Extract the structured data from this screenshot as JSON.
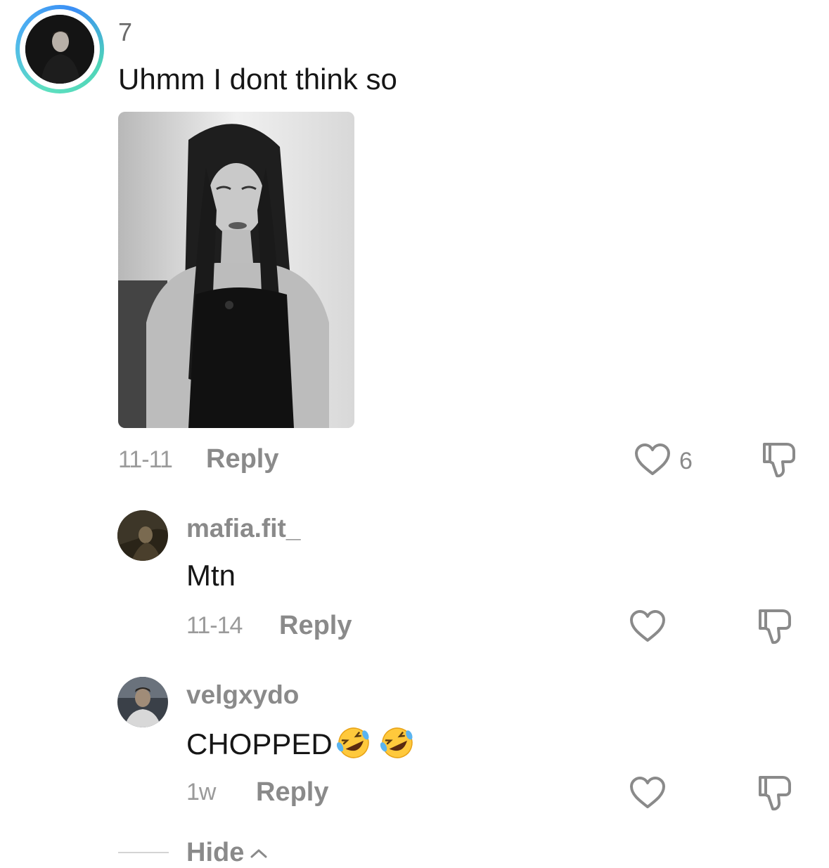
{
  "main_comment": {
    "username": "7",
    "text": "Uhmm I dont think so",
    "date": "11-11",
    "reply_label": "Reply",
    "like_count": "6",
    "avatar_ring_colors": [
      "#5ee0c0",
      "#3a8ef5"
    ]
  },
  "replies": [
    {
      "username": "mafia.fit_",
      "text": "Mtn",
      "date": "11-14",
      "reply_label": "Reply"
    },
    {
      "username": "velgxydo",
      "text": "CHOPPED",
      "emojis": [
        "rolling-on-floor-laughing-emoji",
        "rolling-on-floor-laughing-emoji"
      ],
      "date": "1w",
      "reply_label": "Reply"
    }
  ],
  "hide_label": "Hide",
  "icons": {
    "like": "heart-outline-icon",
    "dislike": "thumbs-down-outline-icon",
    "collapse": "chevron-up-icon"
  },
  "colors": {
    "text_primary": "#161616",
    "text_secondary": "#8a8a8a",
    "icon_stroke": "#8a8a8a"
  }
}
